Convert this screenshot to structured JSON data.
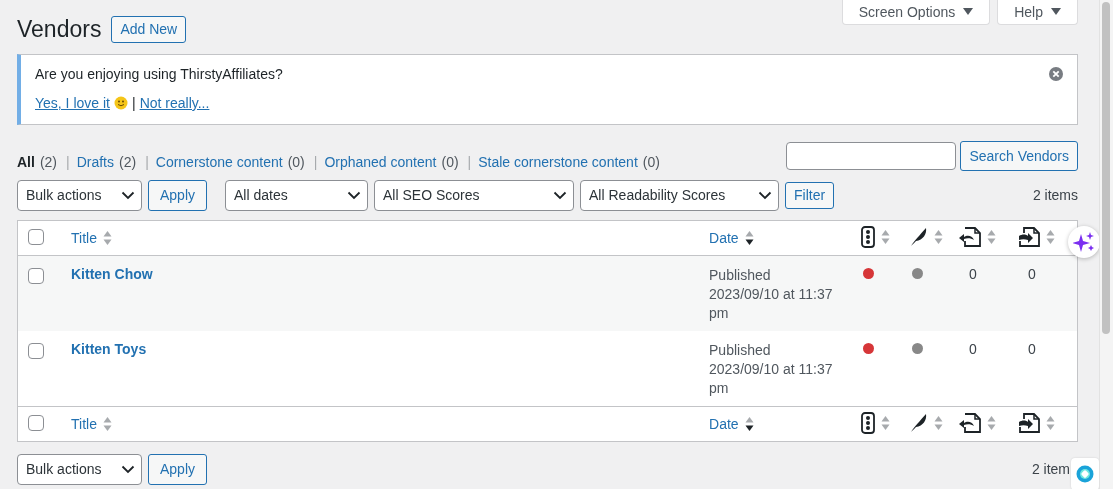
{
  "screen_meta": [
    {
      "label": "Screen Options"
    },
    {
      "label": "Help"
    }
  ],
  "page_title": "Vendors",
  "add_new": "Add New",
  "notice": {
    "question": "Are you enjoying using ThirstyAffiliates?",
    "separator": "|",
    "links": [
      {
        "label": "Yes, I love it"
      },
      {
        "label": "Not really..."
      }
    ]
  },
  "views": {
    "separator": "|",
    "items": [
      {
        "label": "All",
        "count": "(2)",
        "selected": true
      },
      {
        "label": "Drafts",
        "count": "(2)",
        "selected": false
      },
      {
        "label": "Cornerstone content",
        "count": "(0)",
        "selected": false
      },
      {
        "label": "Orphaned content",
        "count": "(0)",
        "selected": false
      },
      {
        "label": "Stale cornerstone content",
        "count": "(0)",
        "selected": false
      }
    ]
  },
  "search": {
    "button": "Search Vendors"
  },
  "tablenav_top": {
    "bulk": "Bulk actions",
    "apply": "Apply",
    "filters": [
      "All dates",
      "All SEO Scores",
      "All Readability Scores"
    ],
    "filter_button": "Filter",
    "count": "2 items"
  },
  "table": {
    "select_all_checked": false,
    "footer_select_all_checked": false,
    "columns": [
      {
        "kind": "title",
        "label": "Title",
        "sorted": false
      },
      {
        "kind": "date",
        "label": "Date",
        "sorted": true
      },
      {
        "kind": "seo",
        "sorted": false
      },
      {
        "kind": "readability",
        "sorted": false
      },
      {
        "kind": "links",
        "sorted": false
      },
      {
        "kind": "linked",
        "sorted": false
      }
    ],
    "rows": [
      {
        "checked": false,
        "title": "Kitten Chow",
        "status": "Published",
        "date": "2023/09/10 at 11:37 pm",
        "scores": [
          {
            "color": "#d63638"
          },
          {
            "color": "#888888"
          }
        ],
        "links": "0",
        "linked": "0"
      },
      {
        "checked": false,
        "title": "Kitten Toys",
        "status": "Published",
        "date": "2023/09/10 at 11:37 pm",
        "scores": [
          {
            "color": "#d63638"
          },
          {
            "color": "#888888"
          }
        ],
        "links": "0",
        "linked": "0"
      }
    ],
    "footer_columns": [
      {
        "kind": "title",
        "label": "Title",
        "sorted": false
      },
      {
        "kind": "date",
        "label": "Date",
        "sorted": true
      },
      {
        "kind": "seo",
        "sorted": false
      },
      {
        "kind": "readability",
        "sorted": false
      },
      {
        "kind": "links",
        "sorted": false
      },
      {
        "kind": "linked",
        "sorted": false
      }
    ]
  },
  "tablenav_bottom": {
    "bulk": "Bulk actions",
    "apply": "Apply",
    "count": "2 item"
  }
}
